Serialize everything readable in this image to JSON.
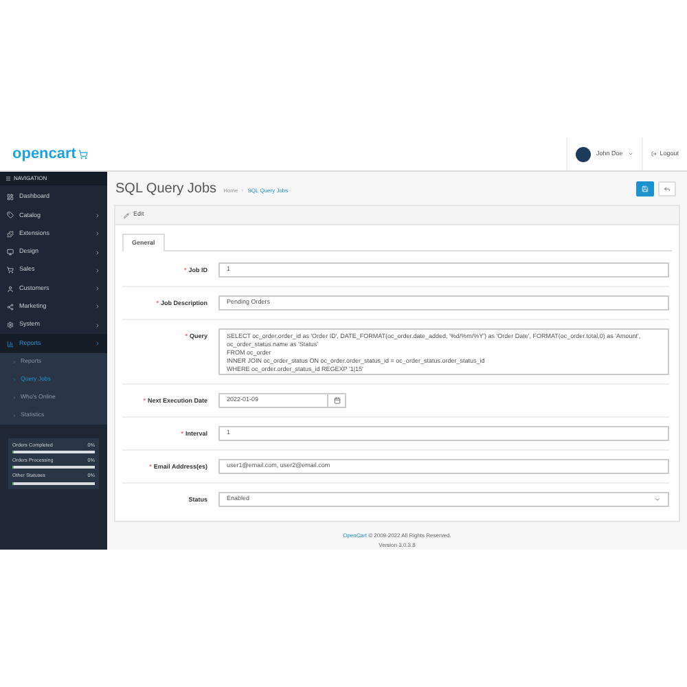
{
  "header": {
    "logo": "opencart",
    "user": "John Doe",
    "logout": "Logout"
  },
  "sidebar": {
    "heading": "NAVIGATION",
    "items": [
      {
        "label": "Dashboard",
        "arrow": false,
        "selected": false
      },
      {
        "label": "Catalog",
        "arrow": true,
        "selected": false
      },
      {
        "label": "Extensions",
        "arrow": true,
        "selected": false
      },
      {
        "label": "Design",
        "arrow": true,
        "selected": false
      },
      {
        "label": "Sales",
        "arrow": true,
        "selected": false
      },
      {
        "label": "Customers",
        "arrow": true,
        "selected": false
      },
      {
        "label": "Marketing",
        "arrow": true,
        "selected": false
      },
      {
        "label": "System",
        "arrow": true,
        "selected": false
      },
      {
        "label": "Reports",
        "arrow": true,
        "selected": true,
        "children": [
          {
            "label": "Reports",
            "selected": false
          },
          {
            "label": "Query Jobs",
            "selected": true
          },
          {
            "label": "Who's Online",
            "selected": false
          },
          {
            "label": "Statistics",
            "selected": false
          }
        ]
      }
    ],
    "stats": [
      {
        "label": "Orders Completed",
        "value": "0%",
        "level": 0
      },
      {
        "label": "Orders Processing",
        "value": "0%",
        "level": 0
      },
      {
        "label": "Other Statuses",
        "value": "0%",
        "level": 0
      }
    ]
  },
  "page": {
    "title": "SQL Query Jobs",
    "breadcrumb": [
      {
        "label": "Home"
      },
      {
        "label": "SQL Query Jobs"
      }
    ]
  },
  "panel": {
    "heading": "Edit",
    "tabs": [
      {
        "label": "General",
        "selected": true
      }
    ],
    "fields": [
      {
        "label": "Job ID",
        "required_mark": "*",
        "kind": "readonly",
        "value": "1"
      },
      {
        "label": "Job Description",
        "required_mark": "*",
        "kind": "text",
        "value": "Pending Orders"
      },
      {
        "label": "Query",
        "required_mark": "*",
        "kind": "textarea",
        "value": "SELECT oc_order.order_id as 'Order ID', DATE_FORMAT(oc_order.date_added, '%d/%m/%Y') as 'Order Date', FORMAT(oc_order.total,0) as 'Amount',\noc_order_status.name as 'Status'\nFROM oc_order\nINNER JOIN oc_order_status ON oc_order.order_status_id = oc_order_status.order_status_id\nWHERE oc_order.order_status_id REGEXP '1|15'"
      },
      {
        "label": "Next Execution Date",
        "required_mark": "*",
        "kind": "date",
        "value": "2022-01-09"
      },
      {
        "label": "Interval",
        "required_mark": "*",
        "kind": "text",
        "value": "1"
      },
      {
        "label": "Email Address(es)",
        "required_mark": "*",
        "kind": "text",
        "value": "user1@email.com, user2@email.com"
      },
      {
        "label": "Status",
        "kind": "select",
        "value": "Enabled"
      }
    ]
  },
  "footer": {
    "link": "OpenCart",
    "copyright": "© 2009-2022 All Rights Reserved.",
    "version": "Version 3.0.3.8"
  }
}
